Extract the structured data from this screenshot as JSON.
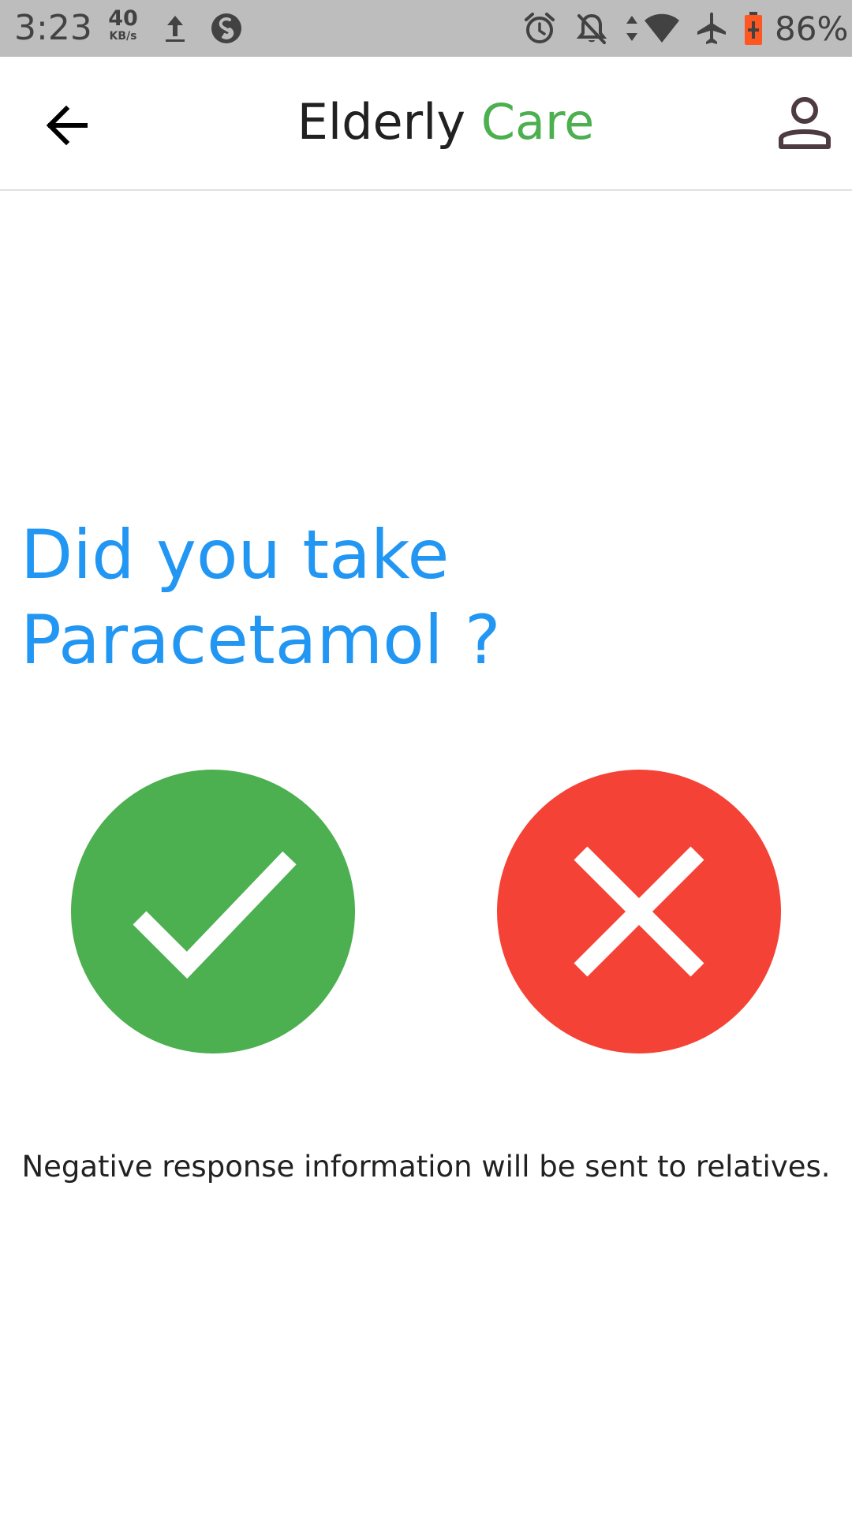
{
  "status_bar": {
    "time": "3:23",
    "net_speed_value": "40",
    "net_speed_unit": "KB/s",
    "battery": "86%",
    "icons": [
      "upload-icon",
      "shazam-icon",
      "alarm-icon",
      "notifications-off-icon",
      "data-arrows-icon",
      "wifi-icon",
      "airplane-icon",
      "battery-charging-icon"
    ]
  },
  "app_bar": {
    "title_part1": "Elderly",
    "title_part2": "Care",
    "back_icon": "arrow-left-icon",
    "profile_icon": "person-icon"
  },
  "question": {
    "line1": "Did you take",
    "line2": "Paracetamol ?"
  },
  "answers": {
    "yes_icon": "checkmark-icon",
    "no_icon": "close-icon"
  },
  "notice": "Negative response information will be sent to relatives.",
  "colors": {
    "accent_green": "#4caf50",
    "question_blue": "#2196f3",
    "no_red": "#f44336",
    "status_bar_bg": "#bdbdbd"
  }
}
